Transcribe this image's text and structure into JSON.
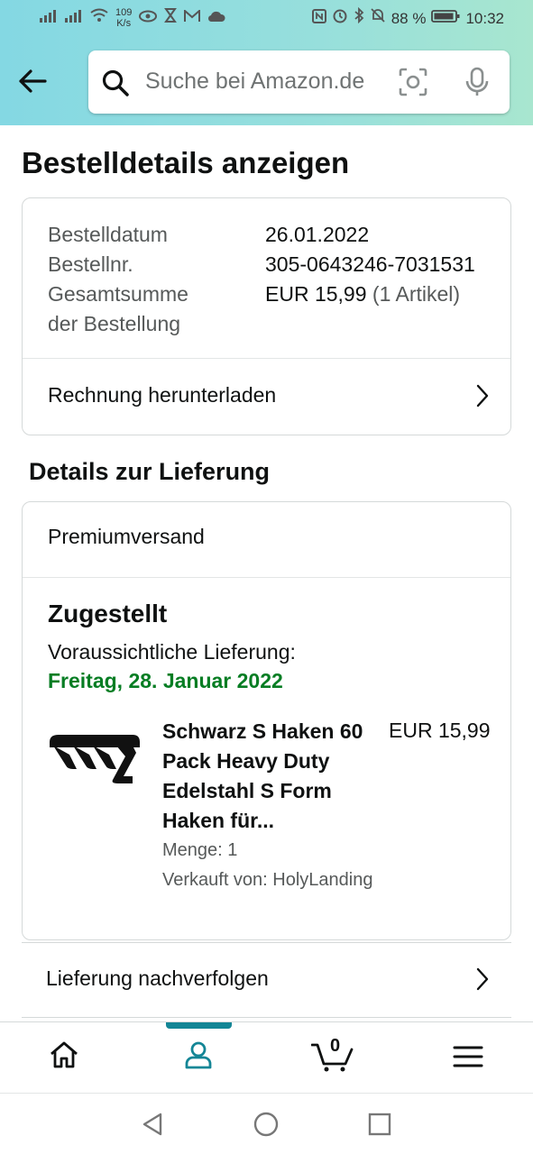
{
  "status_bar": {
    "net_speed_value": "109",
    "net_speed_unit": "K/s",
    "battery": "88 %",
    "time": "10:32",
    "icons": [
      "signal-icon",
      "signal-icon",
      "wifi-icon",
      "eye-icon",
      "hourglass-icon",
      "gmail-icon",
      "cloud-icon",
      "nfc-icon",
      "alarm-icon",
      "bluetooth-icon",
      "mute-icon",
      "battery-icon"
    ]
  },
  "search": {
    "placeholder": "Suche bei Amazon.de"
  },
  "page_title": "Bestelldetails anzeigen",
  "order": {
    "date_label": "Bestelldatum",
    "date_value": "26.01.2022",
    "number_label": "Bestellnr.",
    "number_value": "305-0643246-7031531",
    "total_label_line1": "Gesamtsumme",
    "total_label_line2": "der Bestellung",
    "total_value": "EUR 15,99",
    "total_items": "(1 Artikel)",
    "invoice_link": "Rechnung herunterladen"
  },
  "delivery_section": {
    "title": "Details zur Lieferung",
    "shipping_type": "Premiumversand",
    "status": "Zugestellt",
    "expected_label": "Voraussichtliche Lieferung:",
    "expected_date": "Freitag, 28. Januar 2022",
    "accent_color": "#067d23"
  },
  "product": {
    "title_line1": "Schwarz S Haken 60",
    "title_line2": "Pack Heavy Duty",
    "title_line3": "Edelstahl S Form",
    "title_line4": "Haken für...",
    "price": "EUR 15,99",
    "quantity": "Menge: 1",
    "seller": "Verkauft von: HolyLanding"
  },
  "tracking": {
    "label": "Lieferung nachverfolgen"
  },
  "bottom_nav": {
    "cart_count": "0",
    "active_color": "#148696",
    "items": [
      "home-icon",
      "account-icon",
      "cart-icon",
      "menu-icon"
    ]
  }
}
